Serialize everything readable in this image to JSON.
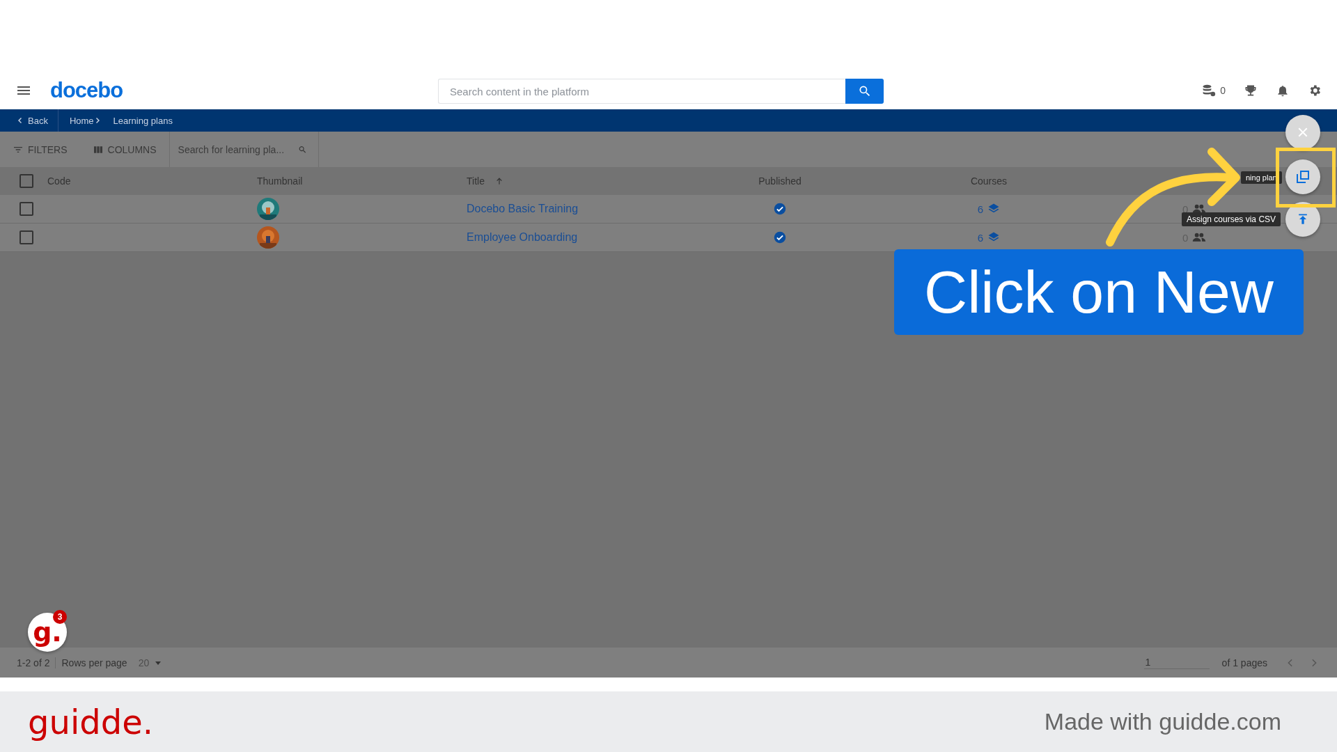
{
  "header": {
    "logo": "docebo",
    "search": {
      "placeholder": "Search content in the platform"
    },
    "credits": "0"
  },
  "breadcrumb": {
    "back": "Back",
    "items": [
      "Home",
      "Learning plans"
    ]
  },
  "toolbar": {
    "filters": "FILTERS",
    "columns": "COLUMNS",
    "search": {
      "placeholder": "Search for learning pla..."
    }
  },
  "table": {
    "all_checked": false,
    "columns": [
      {
        "label": "Code",
        "sorted": false
      },
      {
        "label": "Thumbnail",
        "sorted": false
      },
      {
        "label": "Title",
        "sorted": true
      },
      {
        "label": "Published",
        "sorted": false
      },
      {
        "label": "Courses",
        "sorted": false
      }
    ],
    "rows": [
      {
        "checked": false,
        "title": "Docebo Basic Training",
        "published": true,
        "courses": "6",
        "enrollments": "0"
      },
      {
        "checked": false,
        "title": "Employee Onboarding",
        "published": true,
        "courses": "6",
        "enrollments": "0"
      }
    ]
  },
  "fab": {
    "tooltips": [
      "ning plan",
      "Assign courses via CSV"
    ]
  },
  "callout": "Click on New",
  "helper_badge": {
    "letter": "g.",
    "count": "3"
  },
  "pagination": {
    "range": "1-2 of 2",
    "rows_label": "Rows per page",
    "rows_value": "20",
    "page": "1",
    "pages": "of 1 pages"
  },
  "footer": {
    "logo": "guidde.",
    "credit": "Made with guidde.com"
  }
}
